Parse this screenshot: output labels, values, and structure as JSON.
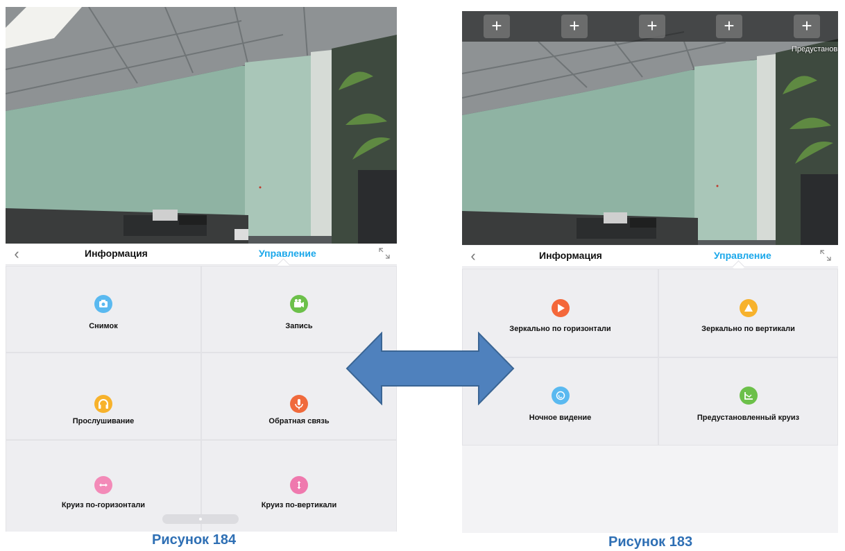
{
  "left_panel": {
    "tabs": {
      "info": "Информация",
      "control": "Управление"
    },
    "buttons": [
      {
        "label": "Снимок",
        "icon": "camera-icon",
        "color": "#5ab9f0"
      },
      {
        "label": "Запись",
        "icon": "video-camera-icon",
        "color": "#6cc04a"
      },
      {
        "label": "Прослушивание",
        "icon": "headphones-icon",
        "color": "#f7b22c"
      },
      {
        "label": "Обратная связь",
        "icon": "microphone-icon",
        "color": "#f06a3c"
      },
      {
        "label": "Круиз  по-горизонтали",
        "icon": "horizontal-arrows-icon",
        "color": "#f38ab8"
      },
      {
        "label": "Круиз по-вертикали",
        "icon": "vertical-arrows-icon",
        "color": "#ef79ae"
      }
    ]
  },
  "right_panel": {
    "tabs": {
      "info": "Информация",
      "control": "Управление"
    },
    "preset_buttons": [
      "+",
      "+",
      "+",
      "+",
      "+"
    ],
    "preset_label": "Предустановк",
    "buttons": [
      {
        "label": "Зеркально по горизонтали",
        "icon": "flip-horizontal-icon",
        "color": "#f4673a"
      },
      {
        "label": "Зеркально по вертикали",
        "icon": "flip-vertical-icon",
        "color": "#f7b22c"
      },
      {
        "label": "Ночное видение",
        "icon": "night-vision-icon",
        "color": "#5ab9f0"
      },
      {
        "label": "Предустановленный круиз",
        "icon": "preset-cruise-icon",
        "color": "#6cc04a"
      }
    ]
  },
  "captions": {
    "left": "Рисунок 184",
    "right": "Рисунок 183"
  },
  "colors": {
    "accent": "#1aa7ea",
    "caption": "#2e6fb4",
    "arrow": "#4f81bd"
  }
}
